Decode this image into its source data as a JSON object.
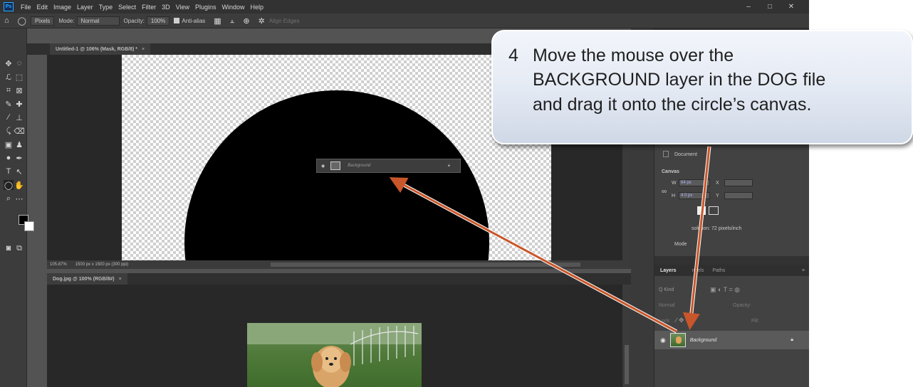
{
  "app": {
    "logo": "Ps",
    "menu": [
      "File",
      "Edit",
      "Image",
      "Layer",
      "Type",
      "Select",
      "Filter",
      "3D",
      "View",
      "Plugins",
      "Window",
      "Help"
    ],
    "window_controls": [
      "–",
      "□",
      "✕"
    ]
  },
  "options_bar": {
    "home_icon": "home-icon",
    "pixels_value": "Pixels",
    "mode_label": "Mode:",
    "mode_value": "Normal",
    "opacity_label": "Opacity:",
    "opacity_value": "100%",
    "antialias_label": "Anti-alias",
    "align_edges_label": "Align Edges"
  },
  "doc1": {
    "tab_title": "Untitled-1 @ 106% (Mask, RGB/8) *",
    "status_zoom": "105.87%",
    "status_size": "1500 px x 1500 px (300 ppi)"
  },
  "drag_ghost": {
    "layer_name": "Background"
  },
  "doc2": {
    "tab_title": "Dog.jpg @ 100% (RGB/8#)"
  },
  "properties": {
    "document_label": "Document",
    "canvas_label": "Canvas",
    "w_label": "W",
    "w_value": "64 px",
    "h_label": "H",
    "h_value": "4 0 px",
    "x_label": "X",
    "y_label": "Y",
    "resolution": "solution: 72 pixels/inch",
    "mode_label": "Mode"
  },
  "layers_panel": {
    "tabs": [
      "Layers",
      "nnels",
      "Paths"
    ],
    "search_kind": "Q Kind",
    "blend_mode": "Normal",
    "opacity_label": "Opacity:",
    "lock_label": "Lock:",
    "fill_label": "Fill:",
    "layer_name": "Background"
  },
  "callout": {
    "step_number": "4",
    "text": "Move the mouse over the\nBACKGROUND layer in the DOG file\nand drag it onto the circle’s canvas."
  },
  "colors": {
    "arrow": "#c8562a",
    "callout_border": "#ffffff",
    "ps_blue": "#31a8ff"
  }
}
